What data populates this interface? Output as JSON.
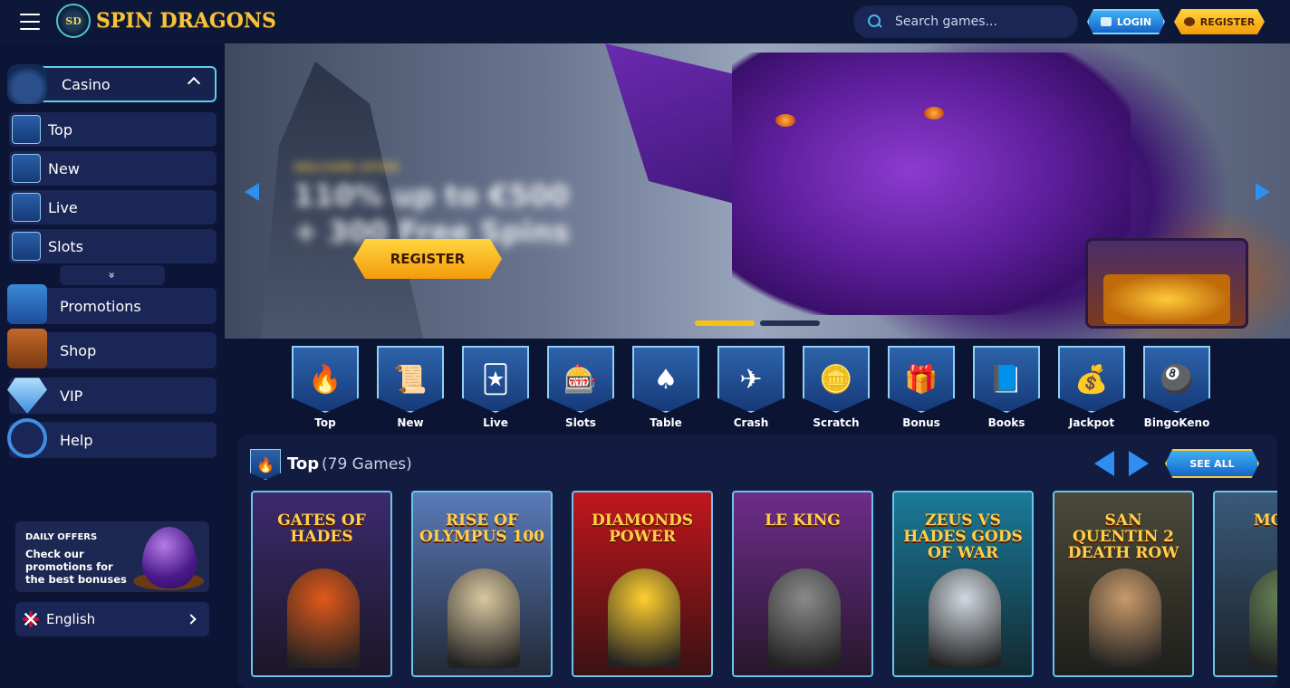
{
  "brand": {
    "name": "SPIN DRAGONS",
    "badge": "SD"
  },
  "header": {
    "search_placeholder": "Search games...",
    "login_label": "LOGIN",
    "register_label": "REGISTER"
  },
  "sidebar": {
    "casino_label": "Casino",
    "sub_items": [
      {
        "label": "Top",
        "icon": "fire-icon"
      },
      {
        "label": "New",
        "icon": "scroll-icon"
      },
      {
        "label": "Live",
        "icon": "cards-icon"
      },
      {
        "label": "Slots",
        "icon": "slot-machine-icon"
      }
    ],
    "expand_glyph": "»",
    "main_items": [
      {
        "label": "Promotions",
        "icon": "gift-icon"
      },
      {
        "label": "Shop",
        "icon": "shop-icon"
      },
      {
        "label": "VIP",
        "icon": "diamond-icon"
      },
      {
        "label": "Help",
        "icon": "headset-icon"
      }
    ],
    "promo": {
      "title": "DAILY OFFERS",
      "description": "Check our promotions for the best bonuses"
    },
    "language": "English"
  },
  "hero": {
    "pre_title": "WELCOME OFFER",
    "headline_1": "110% up to €500",
    "headline_2": "+ 300 Free Spins",
    "register_label": "REGISTER"
  },
  "categories": [
    {
      "label": "Top",
      "glyph": "🔥"
    },
    {
      "label": "New",
      "glyph": "📜"
    },
    {
      "label": "Live",
      "glyph": "🃏"
    },
    {
      "label": "Slots",
      "glyph": "🎰"
    },
    {
      "label": "Table",
      "glyph": "♠"
    },
    {
      "label": "Crash",
      "glyph": "✈"
    },
    {
      "label": "Scratch",
      "glyph": "🪙"
    },
    {
      "label": "Bonus",
      "glyph": "🎁"
    },
    {
      "label": "Books",
      "glyph": "📘"
    },
    {
      "label": "Jackpot",
      "glyph": "💰"
    },
    {
      "label": "BingoKeno",
      "glyph": "🎱"
    }
  ],
  "top_section": {
    "title": "Top",
    "count": "(79 Games)",
    "see_all": "SEE ALL",
    "games": [
      {
        "name": "GATES OF HADES",
        "bg": "#3b2a6e",
        "accent": "#e0581a"
      },
      {
        "name": "RISE OF OLYMPUS 100",
        "bg": "#5a7ab8",
        "accent": "#d9c7a0"
      },
      {
        "name": "DIAMONDS POWER",
        "bg": "#c0161c",
        "accent": "#ffcf30"
      },
      {
        "name": "LE KING",
        "bg": "#6e2c8a",
        "accent": "#8a8a8a"
      },
      {
        "name": "ZEUS VS HADES GODS OF WAR",
        "bg": "#1a7a9a",
        "accent": "#d0d8e0"
      },
      {
        "name": "SAN QUENTIN 2 DEATH ROW",
        "bg": "#4a4a3a",
        "accent": "#c89a6a"
      },
      {
        "name": "MO TR",
        "bg": "#3a5a7a",
        "accent": "#6a8a5a"
      }
    ]
  },
  "colors": {
    "accent_blue": "#2d8ff0",
    "gold": "#f6c21a",
    "panel": "#1a2655"
  }
}
